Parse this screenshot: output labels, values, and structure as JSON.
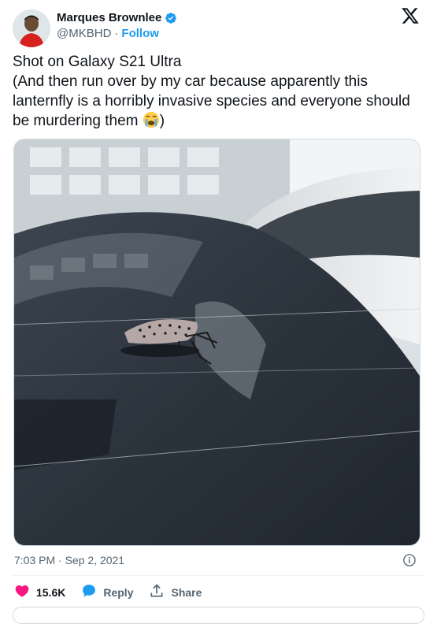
{
  "author": {
    "name": "Marques Brownlee",
    "handle": "@MKBHD",
    "separator": "·",
    "follow_label": "Follow"
  },
  "tweet": {
    "text_line1": "Shot on Galaxy S21 Ultra",
    "text_line2": "(And then run over by my car because apparently this lanternfly is a horribly invasive species and everyone should be murdering them ",
    "text_end": ")",
    "emoji": "crying-face-emoji"
  },
  "meta": {
    "timestamp": "7:03 PM · Sep 2, 2021"
  },
  "actions": {
    "likes_count": "15.6K",
    "reply_label": "Reply",
    "share_label": "Share"
  },
  "colors": {
    "accent": "#1d9bf0",
    "like": "#f91880",
    "muted": "#536471"
  },
  "icons": [
    "verified-badge-icon",
    "x-logo-icon",
    "info-icon",
    "heart-icon",
    "reply-icon",
    "share-icon"
  ]
}
